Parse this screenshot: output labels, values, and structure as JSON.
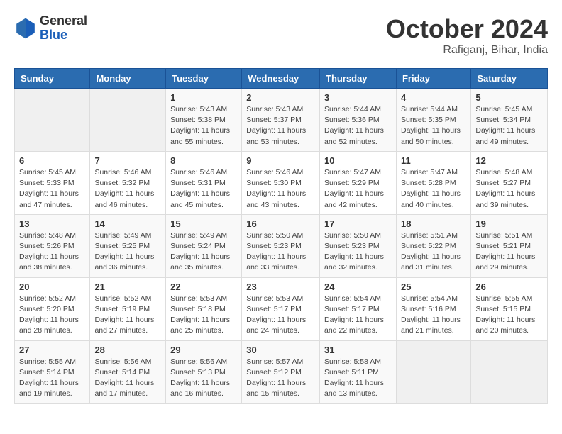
{
  "header": {
    "logo_general": "General",
    "logo_blue": "Blue",
    "month_title": "October 2024",
    "location": "Rafiganj, Bihar, India"
  },
  "days_of_week": [
    "Sunday",
    "Monday",
    "Tuesday",
    "Wednesday",
    "Thursday",
    "Friday",
    "Saturday"
  ],
  "weeks": [
    [
      {
        "day": "",
        "info": ""
      },
      {
        "day": "",
        "info": ""
      },
      {
        "day": "1",
        "info": "Sunrise: 5:43 AM\nSunset: 5:38 PM\nDaylight: 11 hours\nand 55 minutes."
      },
      {
        "day": "2",
        "info": "Sunrise: 5:43 AM\nSunset: 5:37 PM\nDaylight: 11 hours\nand 53 minutes."
      },
      {
        "day": "3",
        "info": "Sunrise: 5:44 AM\nSunset: 5:36 PM\nDaylight: 11 hours\nand 52 minutes."
      },
      {
        "day": "4",
        "info": "Sunrise: 5:44 AM\nSunset: 5:35 PM\nDaylight: 11 hours\nand 50 minutes."
      },
      {
        "day": "5",
        "info": "Sunrise: 5:45 AM\nSunset: 5:34 PM\nDaylight: 11 hours\nand 49 minutes."
      }
    ],
    [
      {
        "day": "6",
        "info": "Sunrise: 5:45 AM\nSunset: 5:33 PM\nDaylight: 11 hours\nand 47 minutes."
      },
      {
        "day": "7",
        "info": "Sunrise: 5:46 AM\nSunset: 5:32 PM\nDaylight: 11 hours\nand 46 minutes."
      },
      {
        "day": "8",
        "info": "Sunrise: 5:46 AM\nSunset: 5:31 PM\nDaylight: 11 hours\nand 45 minutes."
      },
      {
        "day": "9",
        "info": "Sunrise: 5:46 AM\nSunset: 5:30 PM\nDaylight: 11 hours\nand 43 minutes."
      },
      {
        "day": "10",
        "info": "Sunrise: 5:47 AM\nSunset: 5:29 PM\nDaylight: 11 hours\nand 42 minutes."
      },
      {
        "day": "11",
        "info": "Sunrise: 5:47 AM\nSunset: 5:28 PM\nDaylight: 11 hours\nand 40 minutes."
      },
      {
        "day": "12",
        "info": "Sunrise: 5:48 AM\nSunset: 5:27 PM\nDaylight: 11 hours\nand 39 minutes."
      }
    ],
    [
      {
        "day": "13",
        "info": "Sunrise: 5:48 AM\nSunset: 5:26 PM\nDaylight: 11 hours\nand 38 minutes."
      },
      {
        "day": "14",
        "info": "Sunrise: 5:49 AM\nSunset: 5:25 PM\nDaylight: 11 hours\nand 36 minutes."
      },
      {
        "day": "15",
        "info": "Sunrise: 5:49 AM\nSunset: 5:24 PM\nDaylight: 11 hours\nand 35 minutes."
      },
      {
        "day": "16",
        "info": "Sunrise: 5:50 AM\nSunset: 5:23 PM\nDaylight: 11 hours\nand 33 minutes."
      },
      {
        "day": "17",
        "info": "Sunrise: 5:50 AM\nSunset: 5:23 PM\nDaylight: 11 hours\nand 32 minutes."
      },
      {
        "day": "18",
        "info": "Sunrise: 5:51 AM\nSunset: 5:22 PM\nDaylight: 11 hours\nand 31 minutes."
      },
      {
        "day": "19",
        "info": "Sunrise: 5:51 AM\nSunset: 5:21 PM\nDaylight: 11 hours\nand 29 minutes."
      }
    ],
    [
      {
        "day": "20",
        "info": "Sunrise: 5:52 AM\nSunset: 5:20 PM\nDaylight: 11 hours\nand 28 minutes."
      },
      {
        "day": "21",
        "info": "Sunrise: 5:52 AM\nSunset: 5:19 PM\nDaylight: 11 hours\nand 27 minutes."
      },
      {
        "day": "22",
        "info": "Sunrise: 5:53 AM\nSunset: 5:18 PM\nDaylight: 11 hours\nand 25 minutes."
      },
      {
        "day": "23",
        "info": "Sunrise: 5:53 AM\nSunset: 5:17 PM\nDaylight: 11 hours\nand 24 minutes."
      },
      {
        "day": "24",
        "info": "Sunrise: 5:54 AM\nSunset: 5:17 PM\nDaylight: 11 hours\nand 22 minutes."
      },
      {
        "day": "25",
        "info": "Sunrise: 5:54 AM\nSunset: 5:16 PM\nDaylight: 11 hours\nand 21 minutes."
      },
      {
        "day": "26",
        "info": "Sunrise: 5:55 AM\nSunset: 5:15 PM\nDaylight: 11 hours\nand 20 minutes."
      }
    ],
    [
      {
        "day": "27",
        "info": "Sunrise: 5:55 AM\nSunset: 5:14 PM\nDaylight: 11 hours\nand 19 minutes."
      },
      {
        "day": "28",
        "info": "Sunrise: 5:56 AM\nSunset: 5:14 PM\nDaylight: 11 hours\nand 17 minutes."
      },
      {
        "day": "29",
        "info": "Sunrise: 5:56 AM\nSunset: 5:13 PM\nDaylight: 11 hours\nand 16 minutes."
      },
      {
        "day": "30",
        "info": "Sunrise: 5:57 AM\nSunset: 5:12 PM\nDaylight: 11 hours\nand 15 minutes."
      },
      {
        "day": "31",
        "info": "Sunrise: 5:58 AM\nSunset: 5:11 PM\nDaylight: 11 hours\nand 13 minutes."
      },
      {
        "day": "",
        "info": ""
      },
      {
        "day": "",
        "info": ""
      }
    ]
  ]
}
